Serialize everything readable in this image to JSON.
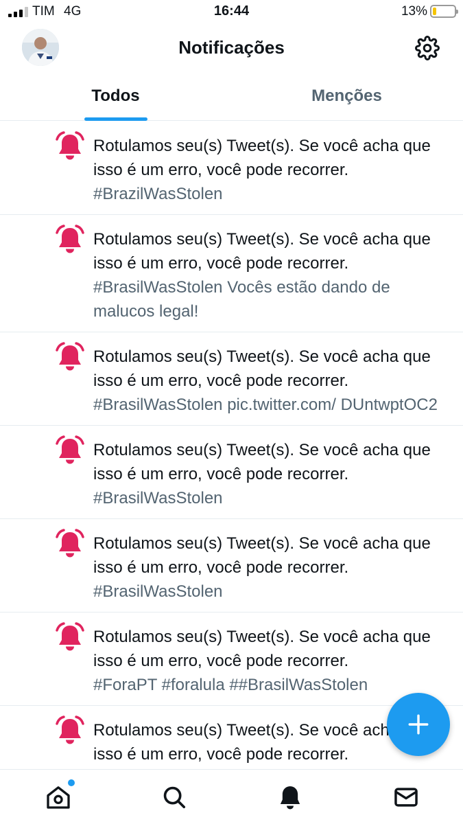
{
  "status_bar": {
    "carrier": "TIM",
    "network": "4G",
    "time": "16:44",
    "battery_percent": "13%"
  },
  "header": {
    "title": "Notificações",
    "avatar_icon": "user-avatar",
    "settings_icon": "gear-icon"
  },
  "tabs": [
    {
      "label": "Todos",
      "active": true
    },
    {
      "label": "Menções",
      "active": false
    }
  ],
  "notifications": [
    {
      "icon": "bell-alert-icon",
      "text": "Rotulamos seu(s) Tweet(s). Se você acha que isso é um erro, você pode recorrer.",
      "detail": "#BrazilWasStolen"
    },
    {
      "icon": "bell-alert-icon",
      "text": "Rotulamos seu(s) Tweet(s). Se você acha que isso é um erro, você pode recorrer.",
      "detail": "#BrasilWasStolen Vocês estão dando de malucos legal!"
    },
    {
      "icon": "bell-alert-icon",
      "text": "Rotulamos seu(s) Tweet(s). Se você acha que isso é um erro, você pode recorrer.",
      "detail": "#BrasilWasStolen pic.twitter.com/ DUntwptOC2"
    },
    {
      "icon": "bell-alert-icon",
      "text": "Rotulamos seu(s) Tweet(s). Se você acha que isso é um erro, você pode recorrer.",
      "detail": "#BrasilWasStolen"
    },
    {
      "icon": "bell-alert-icon",
      "text": "Rotulamos seu(s) Tweet(s). Se você acha que isso é um erro, você pode recorrer.",
      "detail": "#BrasilWasStolen"
    },
    {
      "icon": "bell-alert-icon",
      "text": "Rotulamos seu(s) Tweet(s). Se você acha que isso é um erro, você pode recorrer.",
      "detail": "#ForaPT #foralula ##BrasilWasStolen"
    },
    {
      "icon": "bell-alert-icon",
      "text": "Rotulamos seu(s) Tweet(s). Se você acha que isso é um erro, você pode recorrer.",
      "detail": ""
    }
  ],
  "fab": {
    "icon": "plus-icon"
  },
  "bottom_nav": [
    {
      "icon": "home-icon",
      "has_badge": true
    },
    {
      "icon": "search-icon",
      "has_badge": false
    },
    {
      "icon": "bell-icon",
      "has_badge": false,
      "active": true
    },
    {
      "icon": "mail-icon",
      "has_badge": false
    }
  ],
  "colors": {
    "accent": "#1d9bf0",
    "alert_red": "#e0245e",
    "text_primary": "#0f1419",
    "text_secondary": "#536471",
    "battery_low": "#f5c400"
  }
}
